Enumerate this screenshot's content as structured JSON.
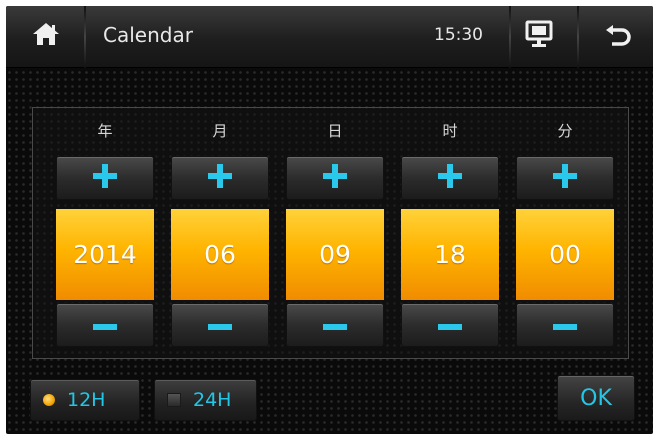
{
  "header": {
    "title": "Calendar",
    "time": "15:30",
    "icons": {
      "home": "home-icon",
      "display": "display-icon",
      "back": "back-arrow-icon"
    }
  },
  "fields": [
    {
      "label": "年",
      "value": "2014"
    },
    {
      "label": "月",
      "value": "06"
    },
    {
      "label": "日",
      "value": "09"
    },
    {
      "label": "时",
      "value": "18"
    },
    {
      "label": "分",
      "value": "00"
    }
  ],
  "time_format": {
    "option_12h": "12H",
    "option_24h": "24H",
    "selected": "12H"
  },
  "ok_label": "OK",
  "colors": {
    "accent": "#22c7e8",
    "value_bg": "#ffb400",
    "indicator_on": "#f3a400"
  }
}
